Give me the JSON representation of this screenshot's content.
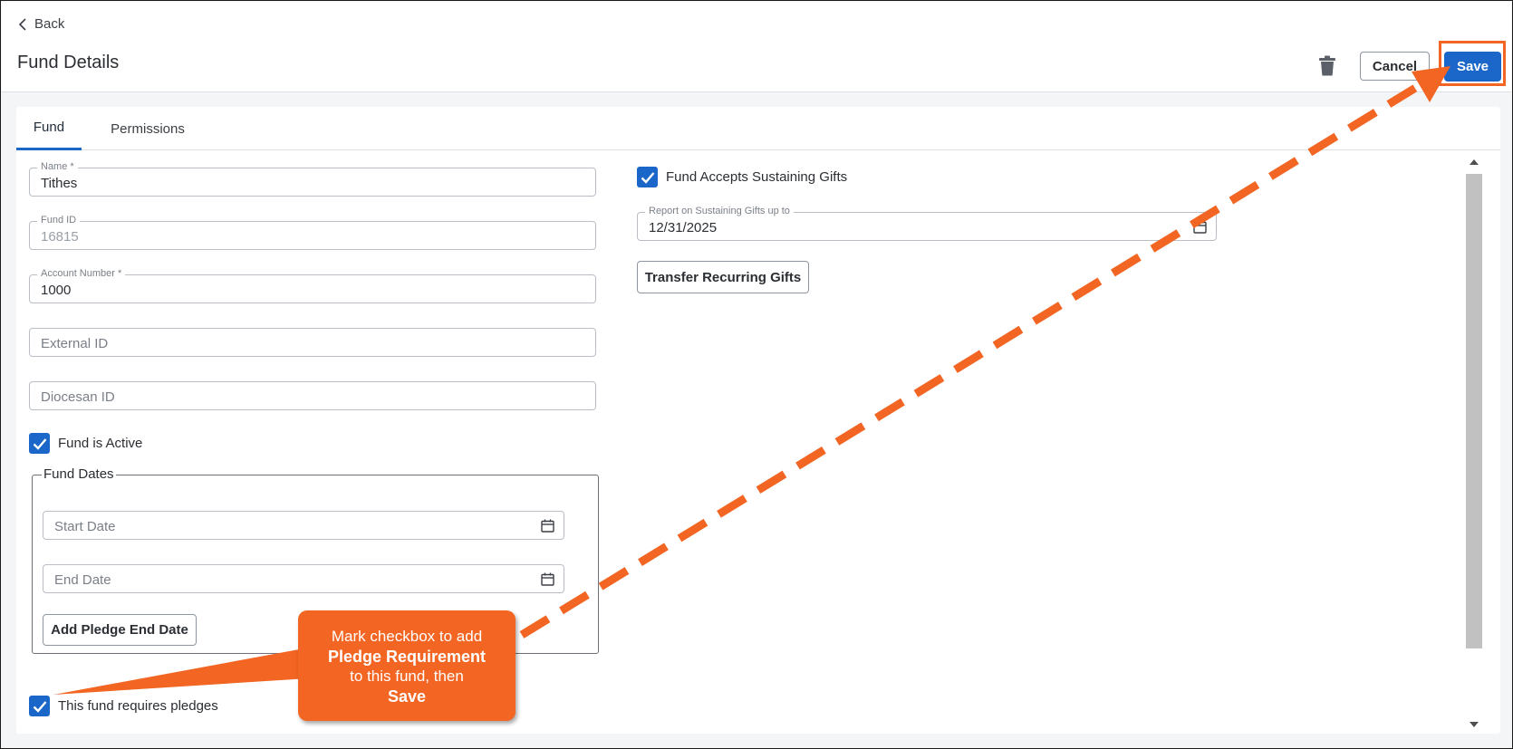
{
  "header": {
    "back_label": "Back",
    "title": "Fund Details",
    "cancel_label": "Cancel",
    "save_label": "Save"
  },
  "tabs": [
    {
      "label": "Fund",
      "active": true
    },
    {
      "label": "Permissions",
      "active": false
    }
  ],
  "form": {
    "name": {
      "label": "Name *",
      "value": "Tithes"
    },
    "fund_id": {
      "label": "Fund ID",
      "value": "16815"
    },
    "account_number": {
      "label": "Account Number *",
      "value": "1000"
    },
    "external_id": {
      "placeholder": "External ID"
    },
    "diocesan_id": {
      "placeholder": "Diocesan ID"
    },
    "fund_active": {
      "label": "Fund is Active",
      "checked": true
    },
    "fund_dates": {
      "legend": "Fund Dates",
      "start_date_placeholder": "Start Date",
      "end_date_placeholder": "End Date",
      "add_pledge_end_label": "Add Pledge End Date"
    },
    "requires_pledges": {
      "label": "This fund requires pledges",
      "checked": true
    },
    "sustaining_gifts": {
      "label": "Fund Accepts Sustaining Gifts",
      "checked": true
    },
    "report_sustaining": {
      "label": "Report on Sustaining Gifts up to",
      "value": "12/31/2025"
    },
    "transfer_label": "Transfer Recurring Gifts"
  },
  "annotation": {
    "line1": "Mark checkbox to add",
    "line2": "Pledge Requirement",
    "line3": "to this fund, then",
    "line4": "Save"
  },
  "colors": {
    "accent": "#1a66c9",
    "annotation": "#f26522"
  },
  "icons": [
    "chevron-left-icon",
    "trash-icon",
    "calendar-icon",
    "checkmark-icon",
    "scroll-up-icon",
    "scroll-down-icon"
  ]
}
